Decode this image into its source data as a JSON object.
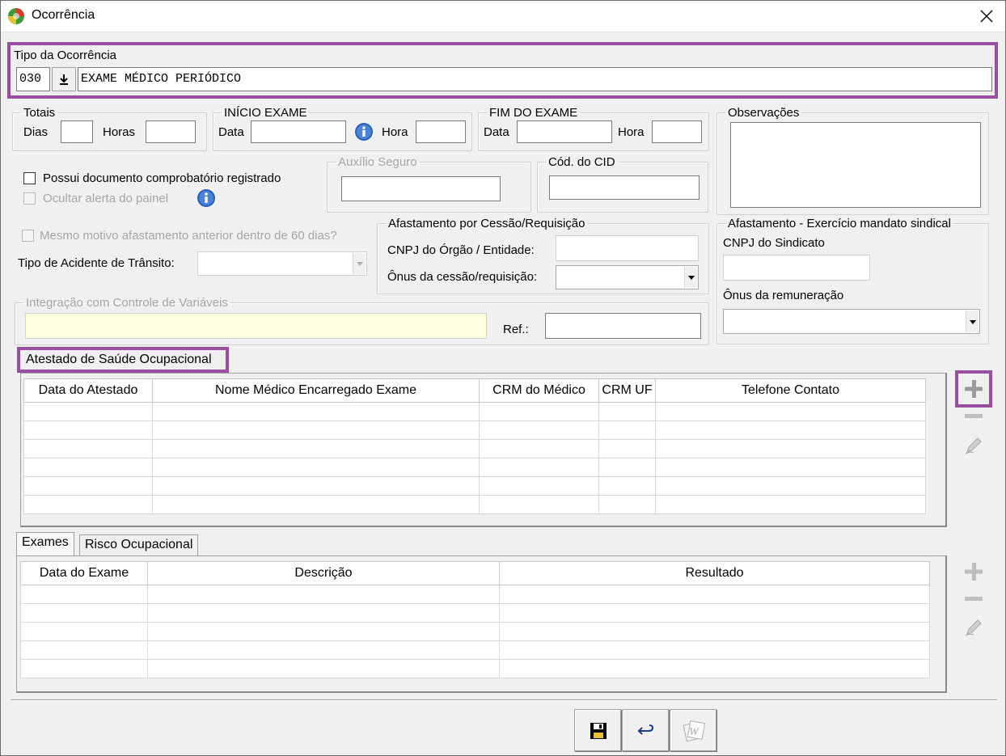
{
  "window": {
    "title": "Ocorrência"
  },
  "tipo": {
    "legend": "Tipo da Ocorrência",
    "code": "030",
    "description": "EXAME MÉDICO PERIÓDICO"
  },
  "totais": {
    "legend": "Totais",
    "dias_label": "Dias",
    "horas_label": "Horas",
    "dias": "",
    "horas": ""
  },
  "inicio": {
    "legend": "INÍCIO EXAME",
    "data_label": "Data",
    "hora_label": "Hora",
    "data": "",
    "hora": ""
  },
  "fim": {
    "legend": "FIM DO EXAME",
    "data_label": "Data",
    "hora_label": "Hora",
    "data": "",
    "hora": ""
  },
  "observacoes": {
    "legend": "Observações",
    "value": ""
  },
  "checks": {
    "possui_doc": "Possui documento comprobatório registrado",
    "ocultar_alerta": "Ocultar alerta do painel",
    "mesmo_motivo": "Mesmo motivo afastamento anterior dentro de 60 dias?"
  },
  "auxilio": {
    "legend": "Auxílio Seguro",
    "value": ""
  },
  "cid": {
    "legend": "Cód. do CID",
    "value": ""
  },
  "acidente": {
    "label": "Tipo de Acidente de Trânsito:",
    "value": ""
  },
  "cessao": {
    "legend": "Afastamento por Cessão/Requisição",
    "cnpj_label": "CNPJ do Órgão / Entidade:",
    "onus_label": "Ônus da cessão/requisição:",
    "cnpj": "",
    "onus": ""
  },
  "sindical": {
    "legend": "Afastamento - Exercício mandato sindical",
    "cnpj_label": "CNPJ do Sindicato",
    "onus_label": "Ônus da remuneração",
    "cnpj": "",
    "onus": ""
  },
  "integracao": {
    "legend": "Integração com Controle de Variáveis",
    "ref_label": "Ref.:",
    "value": "",
    "ref": ""
  },
  "atestado": {
    "title": "Atestado de Saúde Ocupacional",
    "columns": [
      "Data do Atestado",
      "Nome Médico Encarregado Exame",
      "CRM do Médico",
      "CRM UF",
      "Telefone Contato"
    ]
  },
  "tabs": [
    {
      "label": "Exames"
    },
    {
      "label": "Risco Ocupacional"
    }
  ],
  "exames": {
    "columns": [
      "Data do Exame",
      "Descrição",
      "Resultado"
    ]
  },
  "colors": {
    "highlight": "#9a4ea0",
    "integracao_bg": "#ffffe1",
    "info_blue": "#2a5fb8"
  }
}
